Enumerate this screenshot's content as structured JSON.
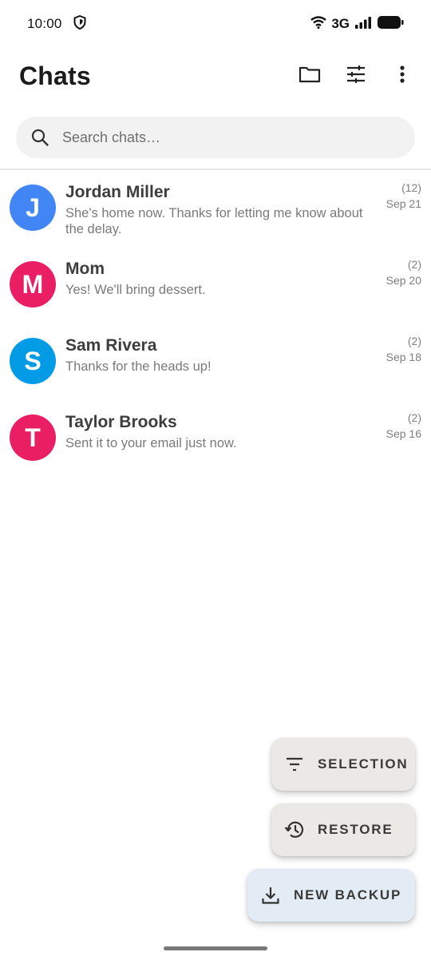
{
  "status_bar": {
    "time": "10:00",
    "network": "3G",
    "icons": [
      "shield-icon",
      "wifi-icon",
      "signal-icon",
      "battery-icon"
    ]
  },
  "header": {
    "title": "Chats",
    "actions": [
      "folder-icon",
      "tune-icon",
      "more-vert-icon"
    ]
  },
  "search": {
    "placeholder": "Search chats…"
  },
  "chats": [
    {
      "initial": "J",
      "name": "Jordan Miller",
      "preview": "She's home now. Thanks for letting me know about the delay.",
      "count": "(12)",
      "date": "Sep 21",
      "color": "#4285f4"
    },
    {
      "initial": "M",
      "name": "Mom",
      "preview": "Yes! We'll bring dessert.",
      "count": "(2)",
      "date": "Sep 20",
      "color": "#e91e63"
    },
    {
      "initial": "S",
      "name": "Sam Rivera",
      "preview": "Thanks for the heads up!",
      "count": "(2)",
      "date": "Sep 18",
      "color": "#039be5"
    },
    {
      "initial": "T",
      "name": "Taylor Brooks",
      "preview": "Sent it to your email just now.",
      "count": "(2)",
      "date": "Sep 16",
      "color": "#e91e63"
    }
  ],
  "fab": {
    "selection_label": "SELECTION",
    "restore_label": "RESTORE",
    "backup_label": "NEW BACKUP"
  }
}
